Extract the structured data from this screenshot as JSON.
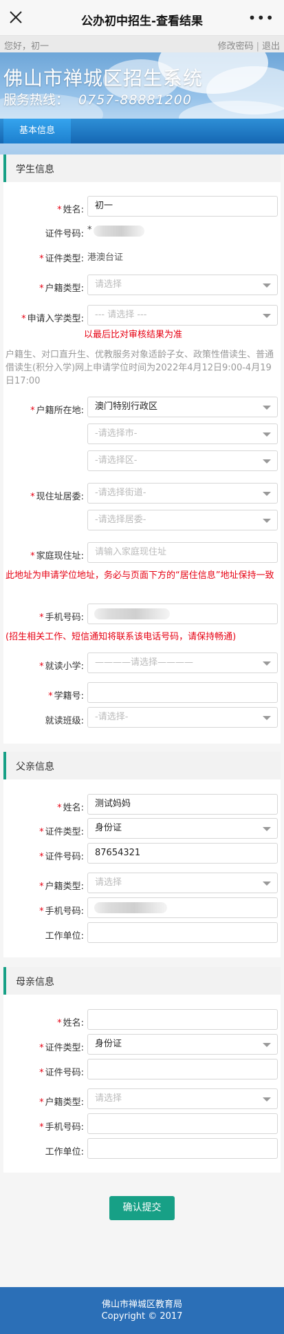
{
  "window": {
    "title": "公办初中招生-查看结果",
    "close_icon": "close-icon",
    "more_icon": "more-dots-icon"
  },
  "userbar": {
    "greeting": "您好，初一",
    "change_password": "修改密码",
    "separator": "|",
    "logout": "退出"
  },
  "banner": {
    "system_name": "佛山市禅城区招生系统",
    "hotline_label": "服务热线：",
    "hotline_number": "0757-88881200",
    "tab_label": "基本信息"
  },
  "student": {
    "section_title": "学生信息",
    "name": {
      "label": "姓名:",
      "value": "初一"
    },
    "id_number": {
      "label": "证件号码:",
      "value": "*"
    },
    "id_type": {
      "label": "证件类型:",
      "value": "港澳台证"
    },
    "hukou_type": {
      "label": "户籍类型:",
      "placeholder": "请选择"
    },
    "apply_type": {
      "label": "申请入学类型:",
      "placeholder": "--- 请选择 ---"
    },
    "audit_note": "以最后比对审核结果为准",
    "info_note": "户籍生、对口直升生、优教服务对象适龄子女、政策性借读生、普通借读生(积分入学)网上申请学位时间为2022年4月12日9:00-4月19日17:00",
    "hukou_location": {
      "label": "户籍所在地:",
      "value": "澳门特别行政区",
      "city_placeholder": "-请选择市-",
      "district_placeholder": "-请选择区-"
    },
    "residence_committee": {
      "label": "现住址居委:",
      "street_placeholder": "-请选择街道-",
      "committee_placeholder": "-请选择居委-"
    },
    "home_address": {
      "label": "家庭现住址:",
      "placeholder": "请输入家庭现住址"
    },
    "address_warning": "此地址为申请学位地址，务必与页面下方的“居住信息”地址保持一致",
    "phone": {
      "label": "手机号码:"
    },
    "phone_warning": "(招生相关工作、短信通知将联系该电话号码，请保持畅通)",
    "primary_school": {
      "label": "就读小学:",
      "placeholder": "————请选择————"
    },
    "student_number": {
      "label": "学籍号:"
    },
    "class": {
      "label": "就读班级:",
      "placeholder": "-请选择-"
    }
  },
  "father": {
    "section_title": "父亲信息",
    "name": {
      "label": "姓名:",
      "value": "测试妈妈"
    },
    "id_type": {
      "label": "证件类型:",
      "value": "身份证"
    },
    "id_number": {
      "label": "证件号码:",
      "value": "87654321"
    },
    "hukou_type": {
      "label": "户籍类型:",
      "placeholder": "请选择"
    },
    "phone": {
      "label": "手机号码:"
    },
    "work_unit": {
      "label": "工作单位:"
    }
  },
  "mother": {
    "section_title": "母亲信息",
    "name": {
      "label": "姓名:"
    },
    "id_type": {
      "label": "证件类型:",
      "value": "身份证"
    },
    "id_number": {
      "label": "证件号码:"
    },
    "hukou_type": {
      "label": "户籍类型:",
      "placeholder": "请选择"
    },
    "phone": {
      "label": "手机号码:"
    },
    "work_unit": {
      "label": "工作单位:"
    }
  },
  "required_mark": "*",
  "submit_label": "确认提交",
  "footer": {
    "org": "佛山市禅城区教育局",
    "copyright": "Copyright © 2017"
  },
  "colors": {
    "accent": "#17a086",
    "required": "#e60012",
    "footer": "#2b6fb7",
    "banner_tab": "#1d7fce"
  }
}
